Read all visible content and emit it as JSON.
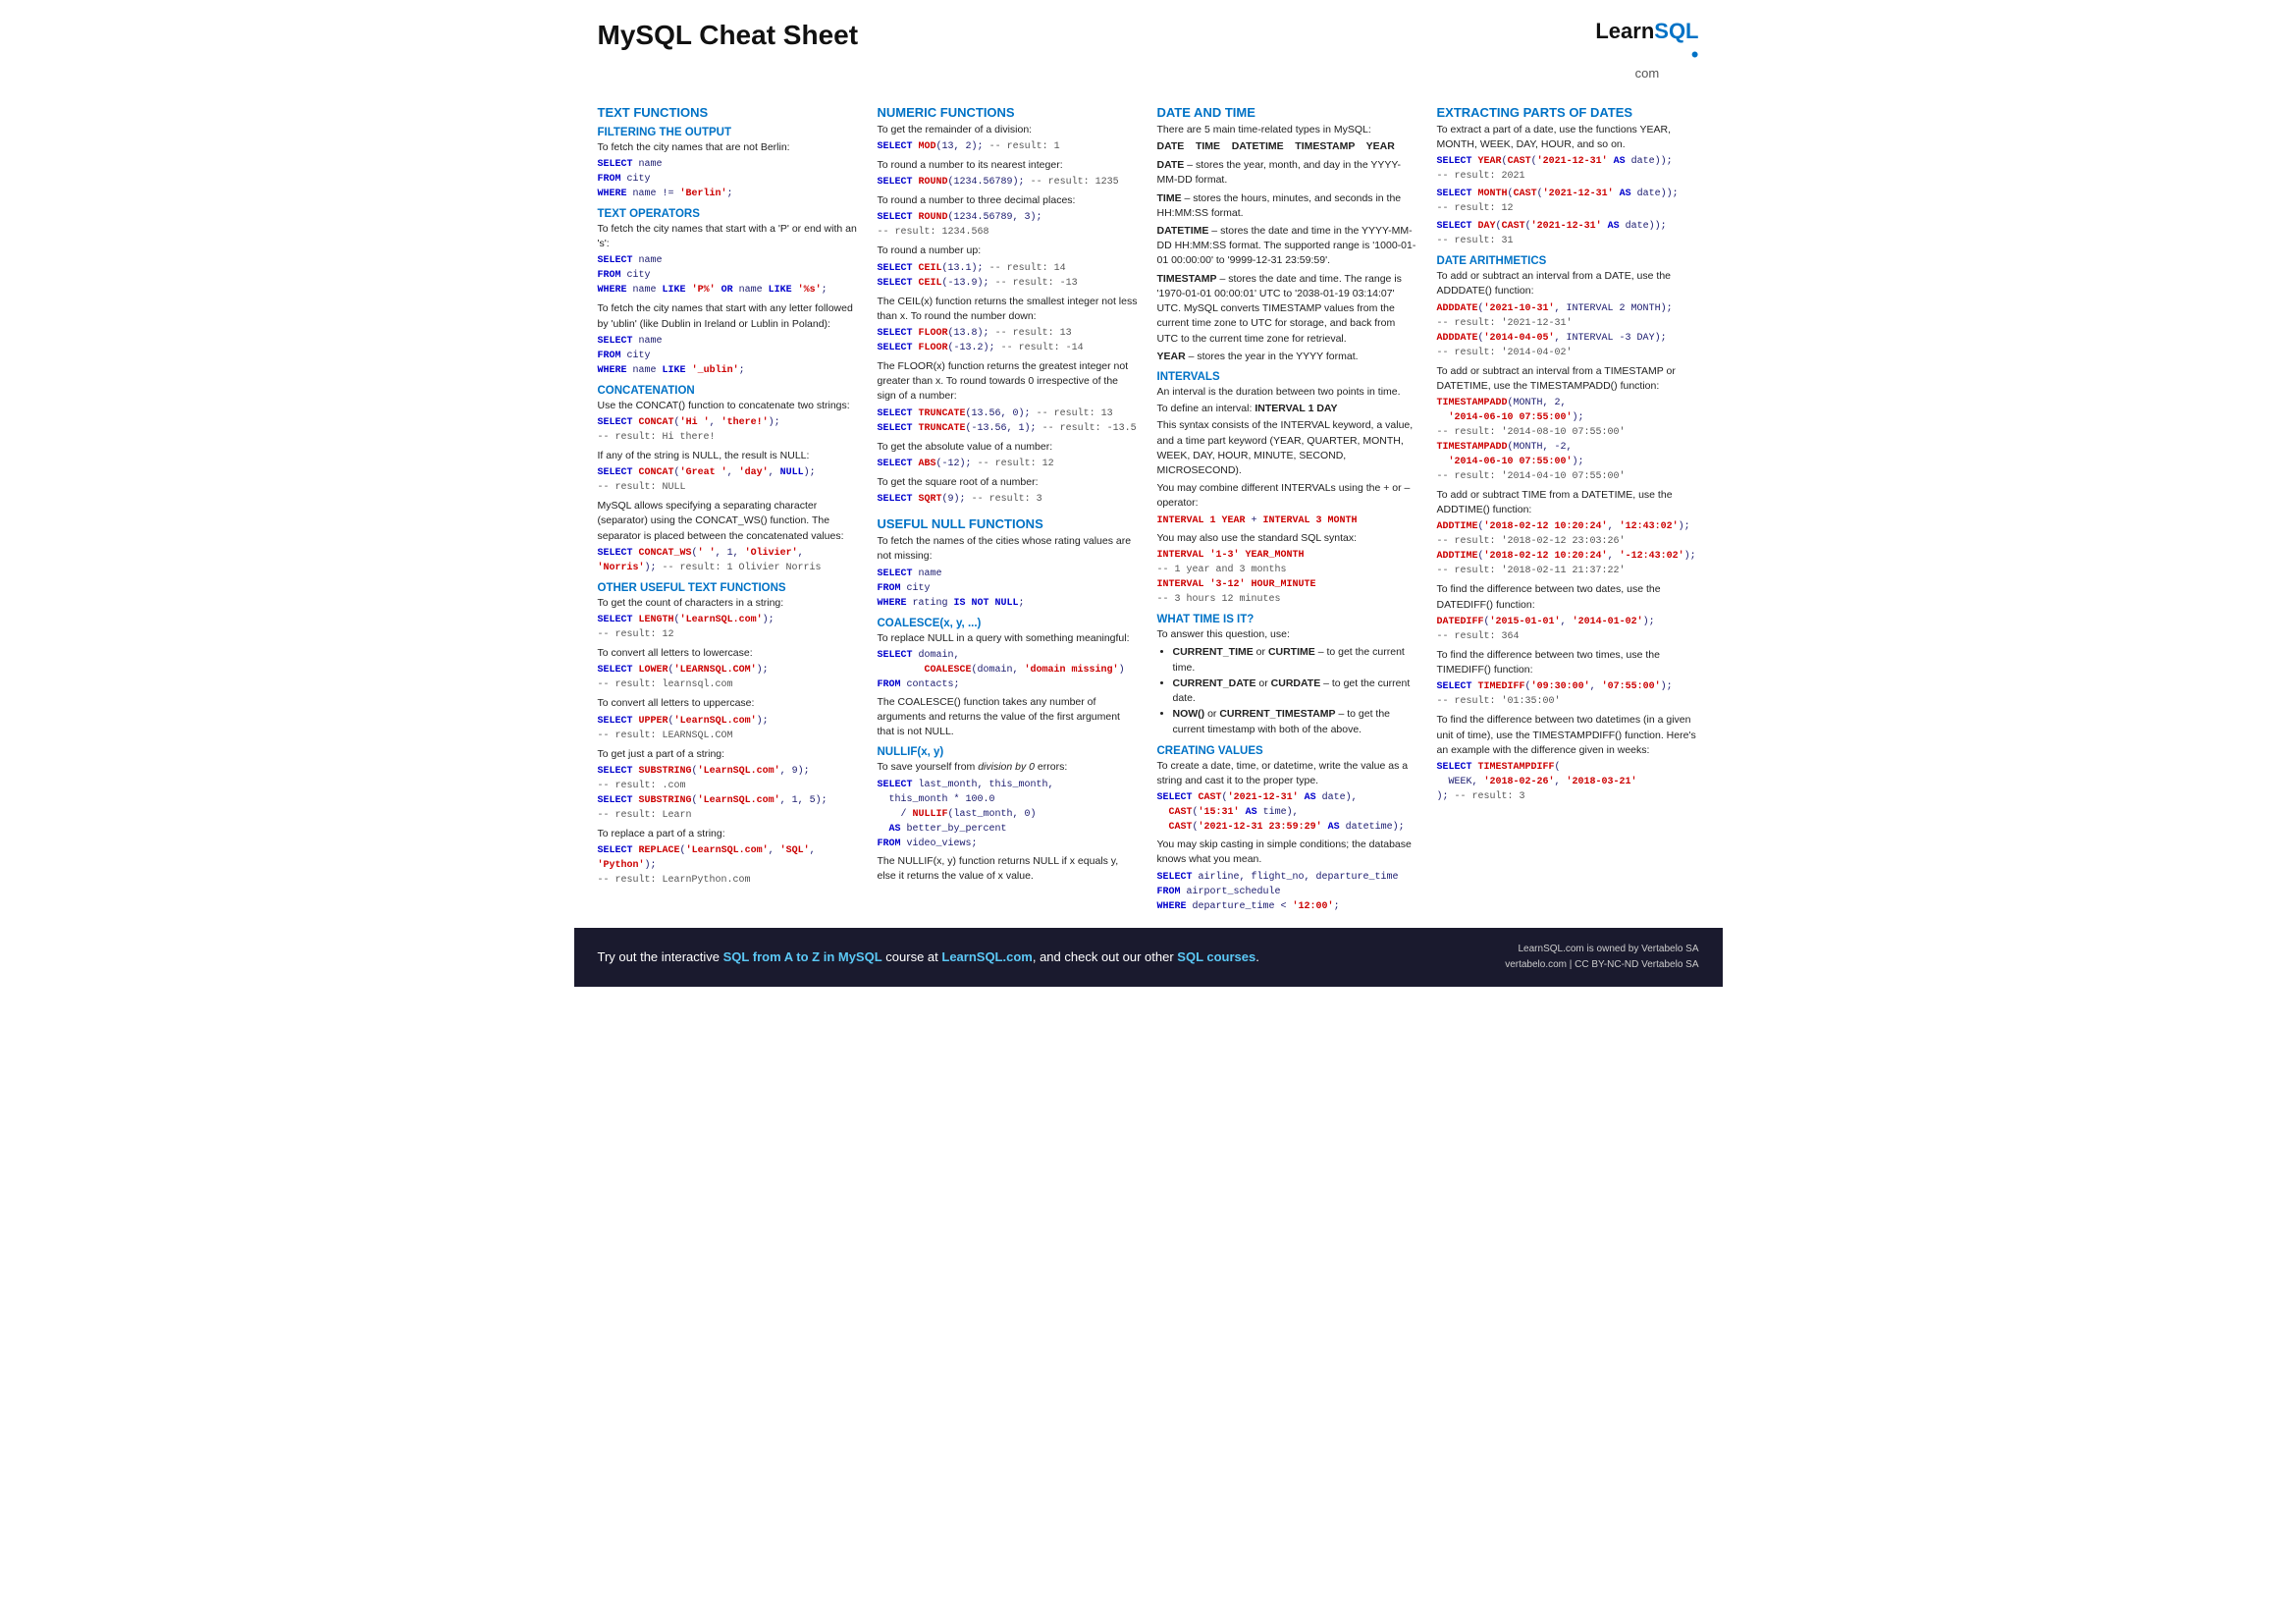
{
  "header": {
    "title": "MySQL Cheat Sheet",
    "logo_learn": "Learn",
    "logo_sql": "SQL",
    "logo_dot": "•",
    "logo_com": "com"
  },
  "footer": {
    "text_start": "Try out the interactive ",
    "link1_text": "SQL from A to Z in MySQL",
    "text_mid": " course at ",
    "link2_text": "LearnSQL.com",
    "text_end": ", and check out our other ",
    "link3_text": "SQL courses",
    "text_final": ".",
    "right_line1": "LearnSQL.com is owned by Vertabelo SA",
    "right_line2": "vertabelo.com | CC BY-NC-ND Vertabelo SA"
  }
}
